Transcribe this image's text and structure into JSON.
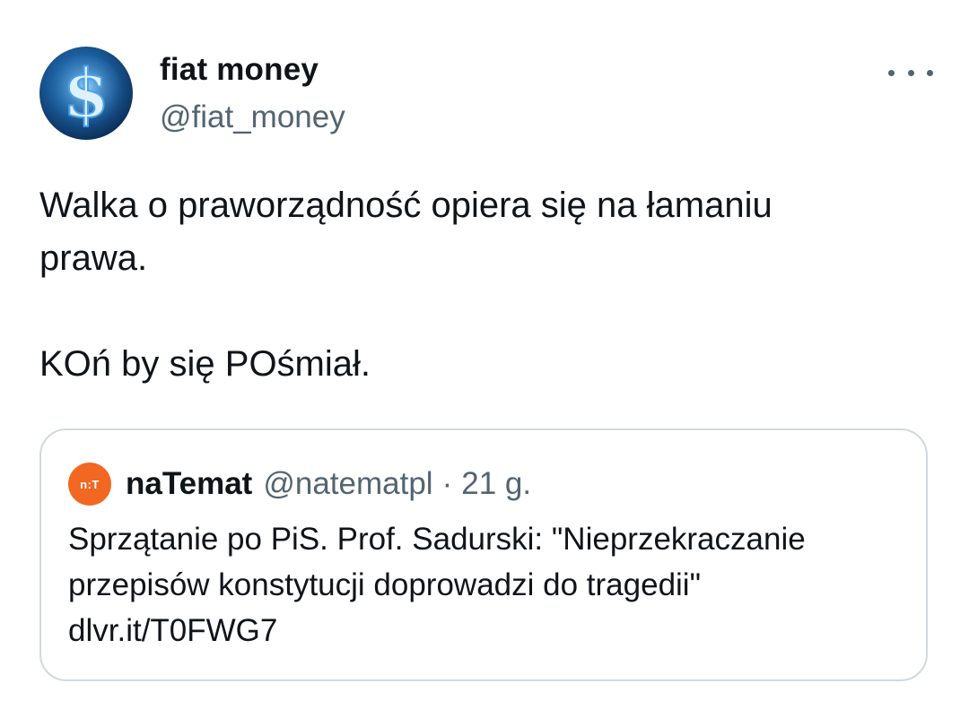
{
  "tweet": {
    "author": {
      "display_name": "fiat money",
      "handle": "@fiat_money",
      "avatar_icon": "dollar-sign-icon"
    },
    "more_icon": "more-horizontal-icon",
    "text_lines": [
      "Walka o praworządność opiera się na łamaniu",
      "prawa.",
      "KOń by się POśmiał."
    ]
  },
  "quoted_tweet": {
    "avatar_text": "n:T",
    "avatar_color": "#f26722",
    "display_name": "naTemat",
    "handle": "@natematpl",
    "separator": "·",
    "time": "21 g.",
    "text_lines": [
      "Sprzątanie po PiS. Prof. Sadurski: \"Nieprzekraczanie",
      "przepisów konstytucji doprowadzi do tragedii\"",
      "dlvr.it/T0FWG7"
    ]
  },
  "colors": {
    "text_primary": "#0f1419",
    "text_secondary": "#536471",
    "border": "#cfd9de"
  }
}
